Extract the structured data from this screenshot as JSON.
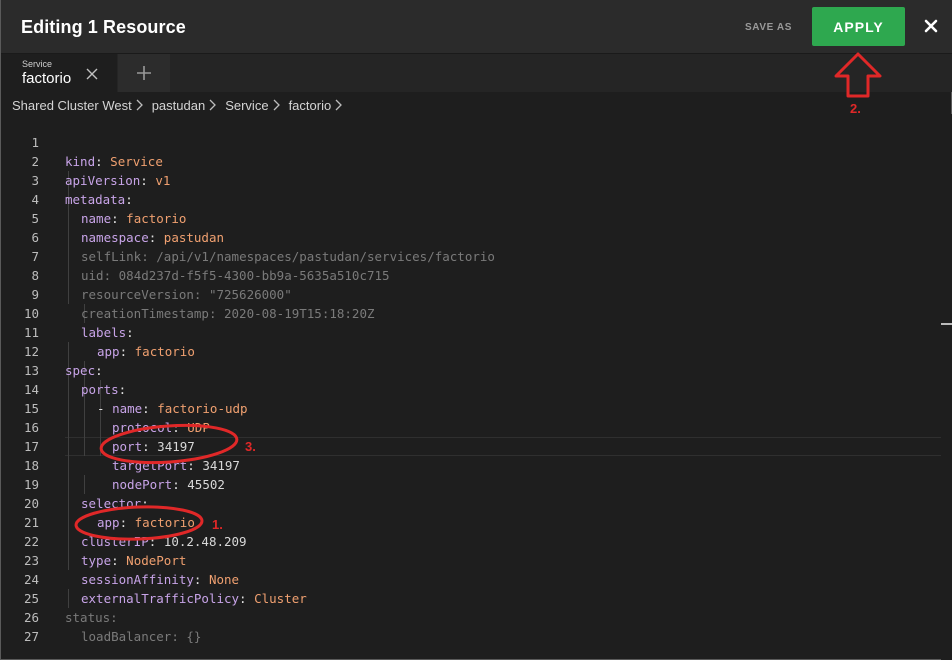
{
  "header": {
    "title": "Editing 1 Resource",
    "save_as_label": "SAVE AS",
    "apply_label": "APPLY",
    "close_icon": "close-icon"
  },
  "tabs": [
    {
      "kind": "Service",
      "name": "factorio"
    }
  ],
  "breadcrumb": [
    "Shared Cluster West",
    "pastudan",
    "Service",
    "factorio"
  ],
  "editor": {
    "lines": [
      {
        "num": "1",
        "key": "kind",
        "value": "Service"
      },
      {
        "num": "2",
        "key": "apiVersion",
        "value": "v1"
      },
      {
        "num": "3",
        "key": "metadata",
        "value": ""
      },
      {
        "num": "4",
        "key": "name",
        "value": "factorio"
      },
      {
        "num": "5",
        "key": "namespace",
        "value": "pastudan"
      },
      {
        "num": "6",
        "key": "selfLink",
        "value": "/api/v1/namespaces/pastudan/services/factorio"
      },
      {
        "num": "7",
        "key": "uid",
        "value": "084d237d-f5f5-4300-bb9a-5635a510c715"
      },
      {
        "num": "8",
        "key": "resourceVersion",
        "value": "\"725626000\""
      },
      {
        "num": "9",
        "key": "creationTimestamp",
        "value": "2020-08-19T15:18:20Z"
      },
      {
        "num": "10",
        "key": "labels",
        "value": ""
      },
      {
        "num": "11",
        "key": "app",
        "value": "factorio"
      },
      {
        "num": "12",
        "key": "spec",
        "value": ""
      },
      {
        "num": "13",
        "key": "ports",
        "value": ""
      },
      {
        "num": "14",
        "key": "name",
        "value": "factorio-udp"
      },
      {
        "num": "15",
        "key": "protocol",
        "value": "UDP"
      },
      {
        "num": "16",
        "key": "port",
        "value": "34197"
      },
      {
        "num": "17",
        "key": "targetPort",
        "value": "34197"
      },
      {
        "num": "18",
        "key": "nodePort",
        "value": "45502"
      },
      {
        "num": "19",
        "key": "selector",
        "value": ""
      },
      {
        "num": "20",
        "key": "app",
        "value": "factorio"
      },
      {
        "num": "21",
        "key": "clusterIP",
        "value": "10.2.48.209"
      },
      {
        "num": "22",
        "key": "type",
        "value": "NodePort"
      },
      {
        "num": "23",
        "key": "sessionAffinity",
        "value": "None"
      },
      {
        "num": "24",
        "key": "externalTrafficPolicy",
        "value": "Cluster"
      },
      {
        "num": "25",
        "key": "status",
        "value": ""
      },
      {
        "num": "26",
        "key": "loadBalancer",
        "value": "{}"
      },
      {
        "num": "27",
        "key": "",
        "value": ""
      }
    ],
    "list_dash": "-"
  },
  "annotations": {
    "step1": "1.",
    "step2": "2.",
    "step3": "3.",
    "color": "#e02828"
  },
  "colors": {
    "apply_green": "#2ea84f",
    "key_purple": "#c8a4e8",
    "value_orange": "#f0a070"
  }
}
